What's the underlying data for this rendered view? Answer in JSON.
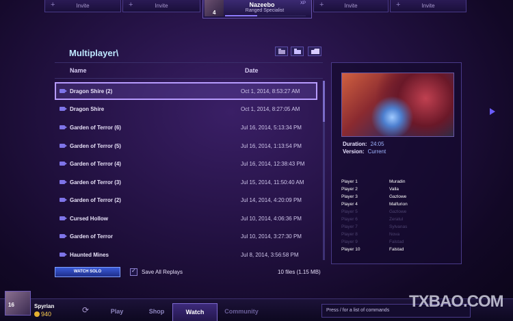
{
  "top_bar": {
    "invite_label": "Invite",
    "hero": {
      "name": "Nazeebo",
      "role": "Ranged Specialist",
      "level": "4",
      "xp_label": "XP"
    }
  },
  "browser": {
    "title": "Multiplayer\\",
    "col_name": "Name",
    "col_date": "Date",
    "rows": [
      {
        "name": "Dragon Shire (2)",
        "date": "Oct 1, 2014, 8:53:27 AM"
      },
      {
        "name": "Dragon Shire",
        "date": "Oct 1, 2014, 8:27:05 AM"
      },
      {
        "name": "Garden of Terror (6)",
        "date": "Jul 16, 2014, 5:13:34 PM"
      },
      {
        "name": "Garden of Terror (5)",
        "date": "Jul 16, 2014, 1:13:54 PM"
      },
      {
        "name": "Garden of Terror (4)",
        "date": "Jul 16, 2014, 12:38:43 PM"
      },
      {
        "name": "Garden of Terror (3)",
        "date": "Jul 15, 2014, 11:50:40 AM"
      },
      {
        "name": "Garden of Terror (2)",
        "date": "Jul 14, 2014, 4:20:09 PM"
      },
      {
        "name": "Cursed Hollow",
        "date": "Jul 10, 2014, 4:06:36 PM"
      },
      {
        "name": "Garden of Terror",
        "date": "Jul 10, 2014, 3:27:30 PM"
      },
      {
        "name": "Haunted Mines",
        "date": "Jul 8, 2014, 3:56:58 PM"
      }
    ],
    "watch_button": "WATCH SOLO",
    "save_all_label": "Save All Replays",
    "file_count": "10 files (1.15 MB)"
  },
  "details": {
    "duration_label": "Duration:",
    "duration_value": "24:05",
    "version_label": "Version:",
    "version_value": "Current",
    "players": [
      {
        "label": "Player 1",
        "hero": "Muradin",
        "dim": false
      },
      {
        "label": "Player 2",
        "hero": "Valla",
        "dim": false
      },
      {
        "label": "Player 3",
        "hero": "Gazlowe",
        "dim": false
      },
      {
        "label": "Player 4",
        "hero": "Malfurion",
        "dim": false
      },
      {
        "label": "Player 5",
        "hero": "Gazlowe",
        "dim": true
      },
      {
        "label": "Player 6",
        "hero": "Zeratul",
        "dim": true
      },
      {
        "label": "Player 7",
        "hero": "Sylvanas",
        "dim": true
      },
      {
        "label": "Player 8",
        "hero": "Nova",
        "dim": true
      },
      {
        "label": "Player 9",
        "hero": "Falstad",
        "dim": true
      },
      {
        "label": "Player 10",
        "hero": "Falstad",
        "dim": false
      }
    ]
  },
  "bottom_bar": {
    "player_name": "Spyrian",
    "player_level": "16",
    "gold": "940",
    "tabs": [
      "Play",
      "Shop",
      "Watch",
      "Community"
    ],
    "active_tab": "Watch",
    "chat_placeholder": "Press / for a list of commands",
    "watermark": "TXBAO.COM"
  }
}
